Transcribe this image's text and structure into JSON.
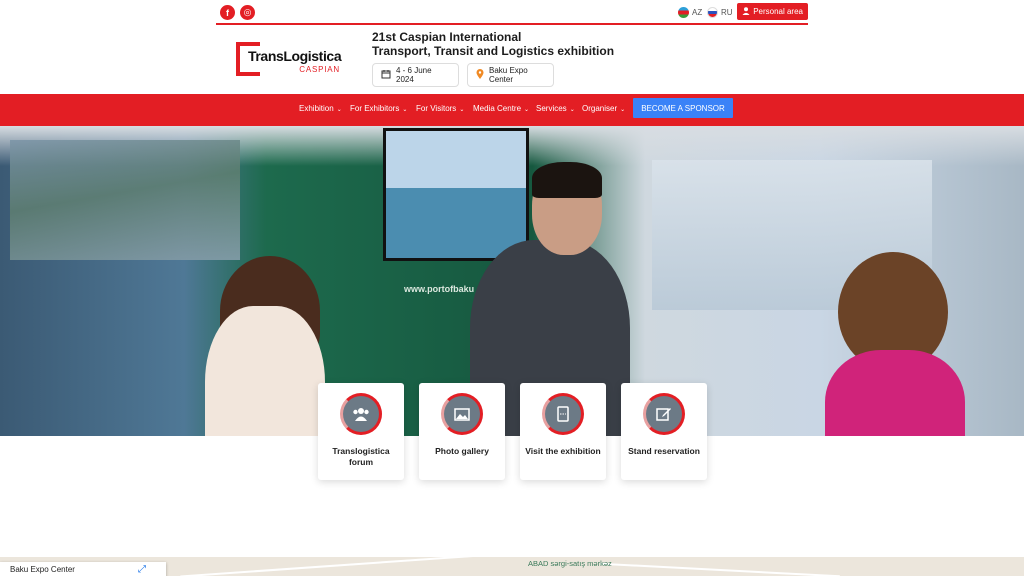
{
  "topbar": {
    "social": [
      {
        "name": "facebook",
        "glyph": "f"
      },
      {
        "name": "instagram",
        "glyph": "◎"
      }
    ],
    "languages": [
      "AZ",
      "RU"
    ],
    "personal_area": "Personal area"
  },
  "header": {
    "logo_main": "TransLogistica",
    "logo_sub": "CASPIAN",
    "title_line1": "21st Caspian International",
    "title_line2": "Transport, Transit and Logistics exhibition",
    "date": "4 - 6 June 2024",
    "venue": "Baku Expo Center"
  },
  "nav": {
    "items": [
      "Exhibition",
      "For Exhibitors",
      "For Visitors",
      "Media Centre",
      "Services",
      "Organiser"
    ],
    "cta": "BECOME A SPONSOR"
  },
  "hero": {
    "sign_text": "www.portofbaku"
  },
  "cards": [
    {
      "label": "Translogistica forum",
      "icon": "people-icon"
    },
    {
      "label": "Photo gallery",
      "icon": "image-icon"
    },
    {
      "label": "Visit the exhibition",
      "icon": "ticket-icon"
    },
    {
      "label": "Stand reservation",
      "icon": "edit-icon"
    }
  ],
  "map": {
    "place": "Baku Expo Center",
    "label": "ABAD sərgi-satış mərkəz"
  },
  "colors": {
    "brand_red": "#e31e24",
    "cta_blue": "#3a82f7"
  }
}
